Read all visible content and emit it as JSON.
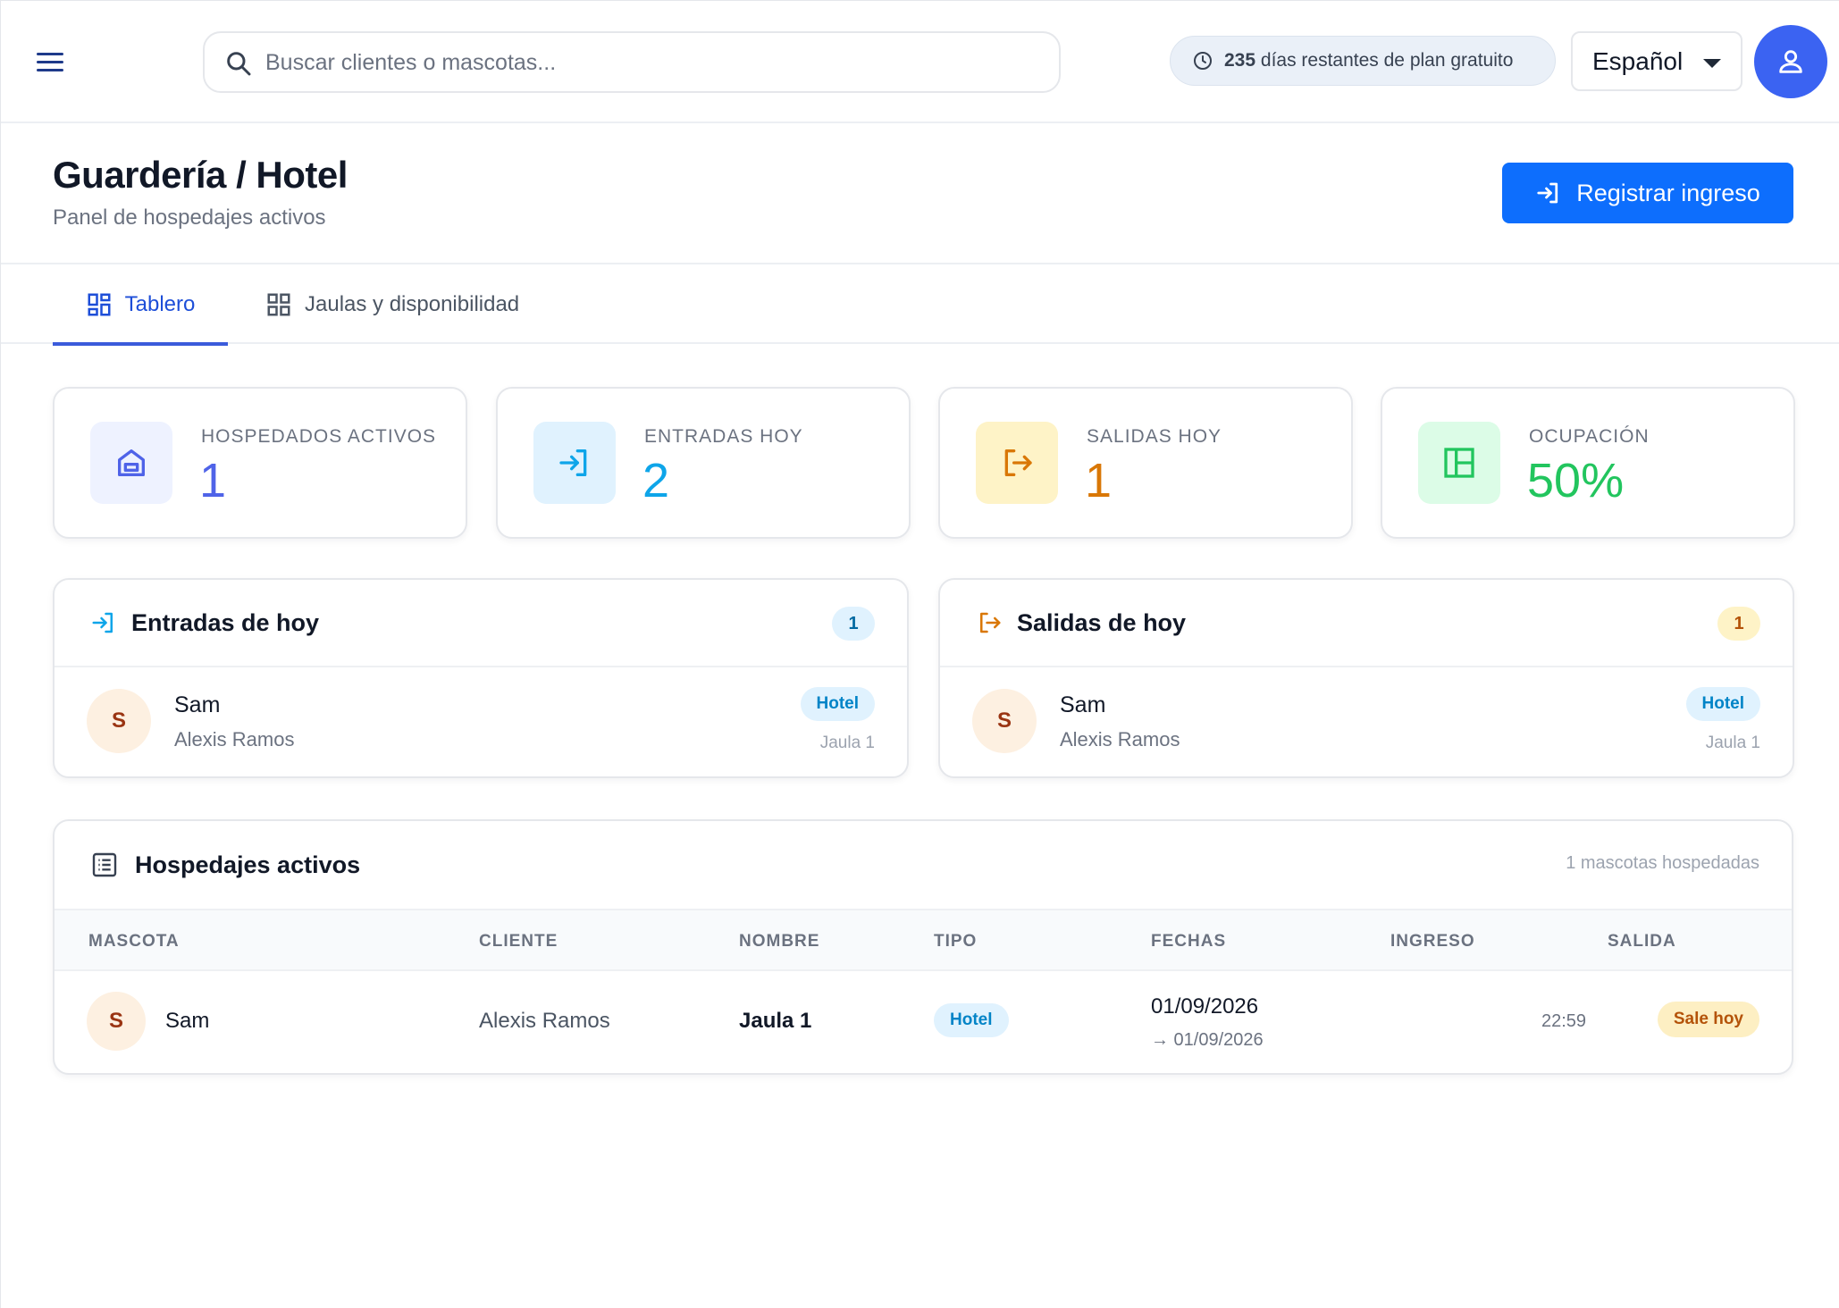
{
  "topbar": {
    "search_placeholder": "Buscar clientes o mascotas...",
    "trial_days": "235",
    "trial_text": "días restantes de plan gratuito",
    "language": "Español"
  },
  "header": {
    "title": "Guardería / Hotel",
    "subtitle": "Panel de hospedajes activos",
    "primary_button": "Registrar ingreso"
  },
  "tabs": [
    {
      "label": "Tablero",
      "active": true
    },
    {
      "label": "Jaulas y disponibilidad",
      "active": false
    }
  ],
  "stats": [
    {
      "label": "HOSPEDADOS ACTIVOS",
      "value": "1",
      "icon": "hotel-icon",
      "color": "#4f63e8",
      "bg": "#eef2ff"
    },
    {
      "label": "ENTRADAS HOY",
      "value": "2",
      "icon": "login-icon",
      "color": "#0ea5e9",
      "bg": "#e0f2fe"
    },
    {
      "label": "SALIDAS HOY",
      "value": "1",
      "icon": "logout-icon",
      "color": "#d97706",
      "bg": "#fef3c7"
    },
    {
      "label": "OCUPACIÓN",
      "value": "50%",
      "icon": "layout-icon",
      "color": "#22c55e",
      "bg": "#dcfce7"
    }
  ],
  "entries_today": {
    "title": "Entradas de hoy",
    "count": "1",
    "items": [
      {
        "initial": "S",
        "pet": "Sam",
        "owner": "Alexis Ramos",
        "type": "Hotel",
        "cage": "Jaula 1"
      }
    ]
  },
  "exits_today": {
    "title": "Salidas de hoy",
    "count": "1",
    "items": [
      {
        "initial": "S",
        "pet": "Sam",
        "owner": "Alexis Ramos",
        "type": "Hotel",
        "cage": "Jaula 1"
      }
    ]
  },
  "active_stays": {
    "title": "Hospedajes activos",
    "meta": "1 mascotas hospedadas",
    "columns": [
      "MASCOTA",
      "CLIENTE",
      "NOMBRE",
      "TIPO",
      "FECHAS",
      "INGRESO",
      "SALIDA"
    ],
    "rows": [
      {
        "initial": "S",
        "pet": "Sam",
        "client": "Alexis Ramos",
        "name": "Jaula 1",
        "type": "Hotel",
        "date_from": "01/09/2026",
        "date_to": "→ 01/09/2026",
        "checkin": "22:59",
        "checkout": "Sale hoy"
      }
    ]
  },
  "colors": {
    "primary": "#0d6efd",
    "avatar": "#3b63f2",
    "tab_active": "#1d4ed8"
  }
}
